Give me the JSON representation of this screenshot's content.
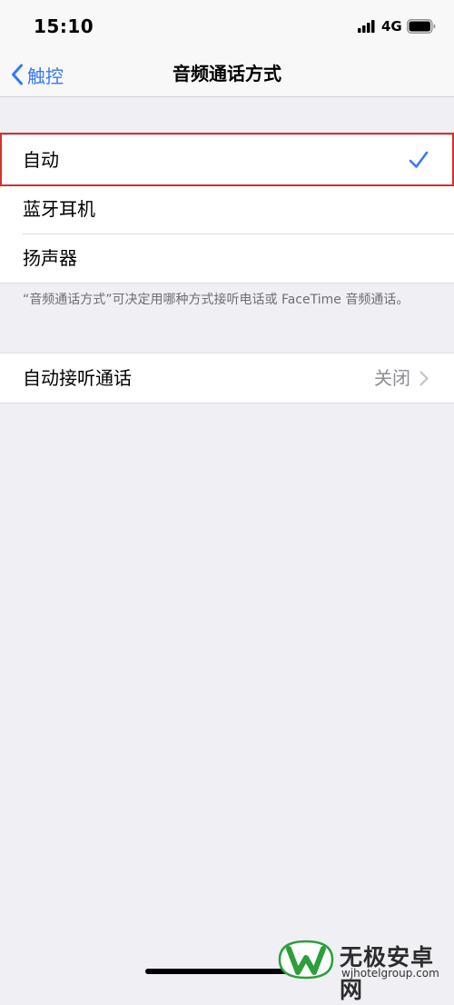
{
  "status_bar": {
    "time": "15:10",
    "network": "4G"
  },
  "nav": {
    "back_label": "触控",
    "title": "音频通话方式"
  },
  "audio_routing": {
    "options": [
      {
        "label": "自动",
        "selected": true
      },
      {
        "label": "蓝牙耳机",
        "selected": false
      },
      {
        "label": "扬声器",
        "selected": false
      }
    ],
    "footnote": "“音频通话方式”可决定用哪种方式接听电话或 FaceTime 音频通话。"
  },
  "auto_answer": {
    "label": "自动接听通话",
    "value": "关闭"
  },
  "watermark": {
    "name": "无极安卓网",
    "url": "wjhotelgroup.com"
  },
  "colors": {
    "accent": "#3478f6",
    "highlight_border": "#d8302c",
    "background": "#efeff4",
    "watermark_green": "#2e9e3a"
  },
  "icons": {
    "back": "chevron-left-icon",
    "selected": "checkmark-icon",
    "disclosure": "chevron-right-icon",
    "signal": "signal-bars-icon",
    "battery": "battery-icon"
  }
}
